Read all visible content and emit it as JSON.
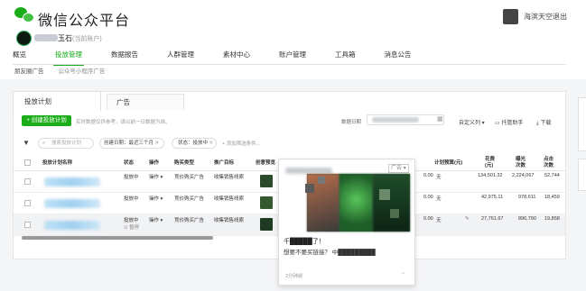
{
  "header": {
    "brand": "微信公众平台",
    "user_name": "海滨天空",
    "logout": "退出"
  },
  "account": {
    "name": "玉石",
    "type": "(当前账户)"
  },
  "nav": {
    "items": [
      "概览",
      "投放管理",
      "数据报告",
      "人群管理",
      "素材中心",
      "账户管理",
      "工具箱",
      "消息公告"
    ],
    "active": "投放管理"
  },
  "subnav": {
    "items": [
      "朋友圈广告",
      "公众号小程序广告"
    ]
  },
  "tabs": {
    "plan": "投放计划",
    "ad": "广告"
  },
  "toolbar": {
    "create": "+ 创建投放计划",
    "hint": "实时数据仅供参考，请以前一日数据为准。",
    "date_label": "数据日期",
    "custom_cols": "自定义列 ▾",
    "trust": "托管助手",
    "download": "下载"
  },
  "filters": {
    "search_placeholder": "搜索投放计划",
    "created_chip": "创建日期：最近三个月",
    "status_chip": "状态：投放中",
    "add_condition": "+ 添加筛选条件..."
  },
  "table": {
    "headers": {
      "name": "投放计划名称",
      "status": "状态",
      "action": "操作",
      "buy": "购买类型",
      "target": "推广目标",
      "preview": "创意预览",
      "plan_budget": "计划预算(元)",
      "spend": "花费(元)",
      "exposure": "曝光次数",
      "clicks": "点击次数"
    },
    "rows": [
      {
        "status": "投放中",
        "action": "操作",
        "buy": "竞价购买广告",
        "target": "收集销售线索",
        "budget_tail": "0.00",
        "plan_budget": "无",
        "spend": "134,501.32",
        "exposure": "2,224,067",
        "clicks": "52,744"
      },
      {
        "status": "投放中",
        "action": "操作",
        "buy": "竞价购买广告",
        "target": "收集销售线索",
        "budget_tail": "0.00",
        "plan_budget": "无",
        "spend": "42,975.11",
        "exposure": "978,611",
        "clicks": "18,459"
      },
      {
        "status": "投放中",
        "status2": "⊙ 暂停",
        "action": "操作",
        "buy": "竞价购买广告",
        "target": "收集销售线索",
        "budget_tail": "0.00",
        "plan_budget": "无",
        "spend": "27,761.67",
        "exposure": "896,790",
        "clicks": "19,858"
      }
    ]
  },
  "popup": {
    "badge": "广告",
    "title": "千█████了！",
    "desc": "想要不要买链接？ 中█████████",
    "time": "2分钟前",
    "more": "··"
  },
  "colors": {
    "brand_green": "#1aad19"
  }
}
